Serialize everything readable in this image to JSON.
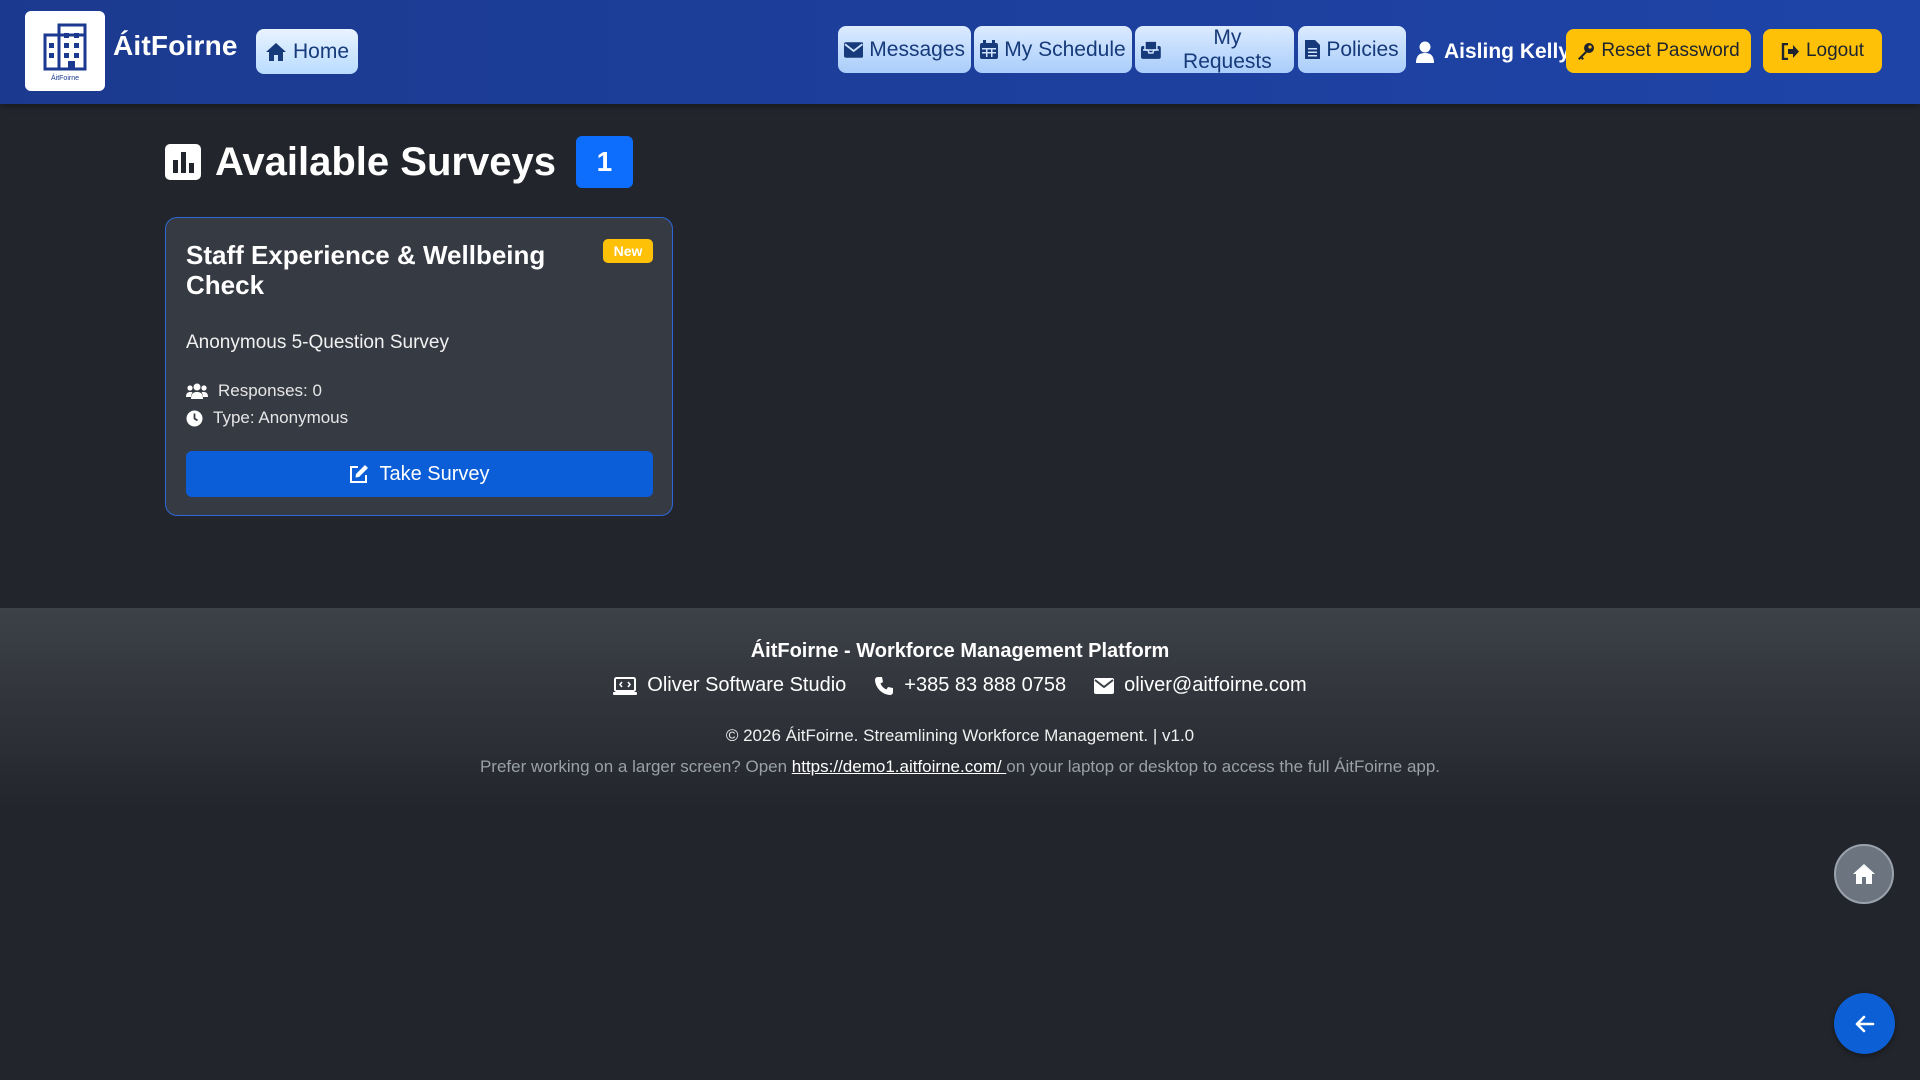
{
  "navbar": {
    "brand": "ÁitFoirne",
    "logo_caption": "ÁitFoirne",
    "home_label": "Home",
    "items": [
      {
        "label": "Messages",
        "icon": "envelope-icon"
      },
      {
        "label": "My Schedule",
        "icon": "calendar-icon"
      },
      {
        "label": "My Requests",
        "icon": "inbox-icon"
      },
      {
        "label": "Policies",
        "icon": "document-icon"
      }
    ],
    "user_name": "Aisling Kelly",
    "reset_password_label": "Reset Password",
    "logout_label": "Logout",
    "colors": {
      "navbar": "#1d3f9c",
      "nav_button": "#b9dcff",
      "warning": "#ffc107",
      "primary": "#0d6efd"
    }
  },
  "main": {
    "title": "Available Surveys",
    "count": "1",
    "survey": {
      "title": "Staff Experience & Wellbeing Check",
      "badge": "New",
      "subtitle": "Anonymous 5-Question Survey",
      "responses": "Responses: 0",
      "type": "Type: Anonymous",
      "button_label": "Take Survey"
    }
  },
  "footer": {
    "title": "ÁitFoirne - Workforce Management Platform",
    "company": "Oliver Software Studio",
    "phone": "+385 83 888 0758",
    "email": "oliver@aitfoirne.com",
    "copyright": "© 2026 ÁitFoirne. Streamlining Workforce Management. | v1.0",
    "note_before": "Prefer working on a larger screen? Open ",
    "note_link": "https://demo1.aitfoirne.com/ ",
    "note_after": "on your laptop or desktop to access the full ÁitFoirne app."
  },
  "floating": {
    "home_icon": "home-icon",
    "back_icon": "arrow-left-icon"
  }
}
